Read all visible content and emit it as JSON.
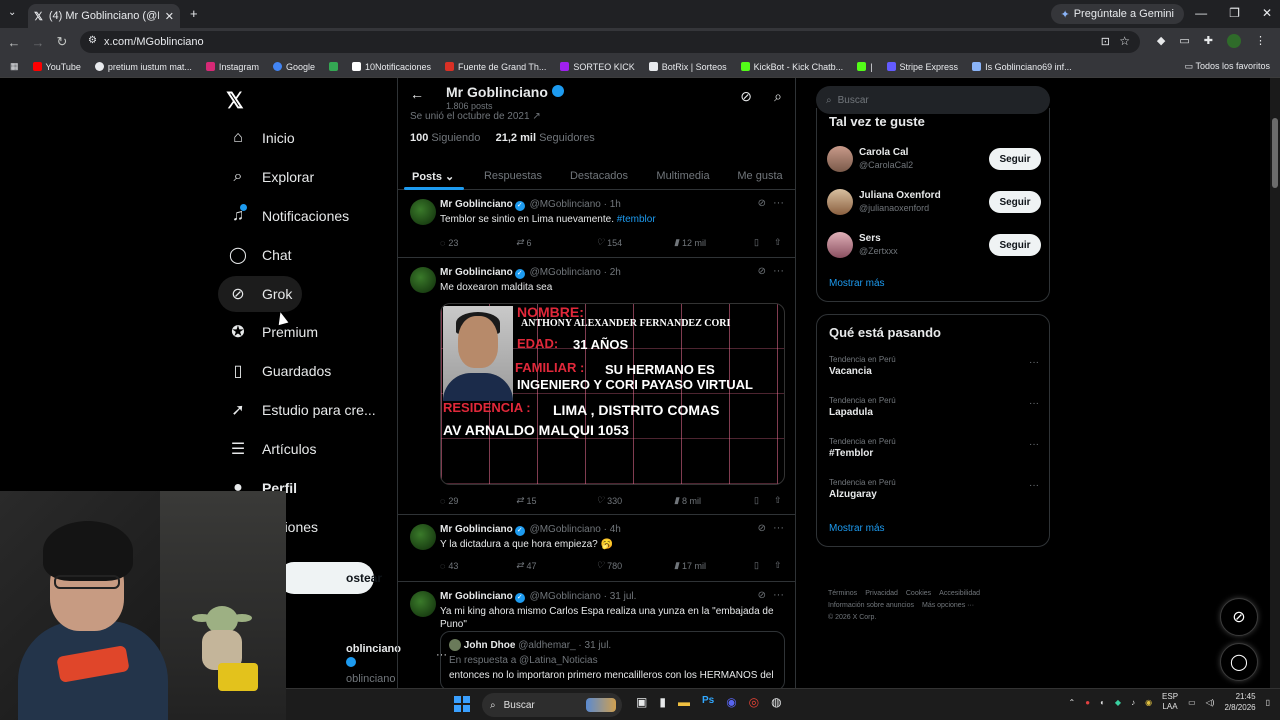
{
  "browser": {
    "tab_title": "(4) Mr Goblinciano (@MGoblin...",
    "gemini_label": "Pregúntale a Gemini",
    "url": "x.com/MGoblinciano",
    "bookmarks": [
      {
        "label": "YouTube",
        "color": "#ff0000"
      },
      {
        "label": "pretium iustum mat...",
        "color": "#e8eaed"
      },
      {
        "label": "Instagram",
        "color": "#d62976"
      },
      {
        "label": "Google",
        "color": "#4285f4"
      },
      {
        "label": "",
        "color": "#34a853"
      },
      {
        "label": "10Notificaciones",
        "color": "#ffffff"
      },
      {
        "label": "Fuente de Grand Th...",
        "color": "#d93025"
      },
      {
        "label": "SORTEO KICK",
        "color": "#a020f0"
      },
      {
        "label": "BotRix | Sorteos",
        "color": "#e8eaed"
      },
      {
        "label": "KickBot - Kick Chatb...",
        "color": "#53fc18"
      },
      {
        "label": "|",
        "color": "#53fc18"
      },
      {
        "label": "Stripe Express",
        "color": "#635bff"
      },
      {
        "label": "Is Goblinciano69 inf...",
        "color": "#8ab4f8"
      }
    ],
    "bookmarks_all": "Todos los favoritos"
  },
  "sidebar": {
    "logo": "𝕏",
    "items": [
      {
        "label": "Inicio",
        "icon": "home-icon",
        "glyph": "⌂"
      },
      {
        "label": "Explorar",
        "icon": "search-icon",
        "glyph": "⌕"
      },
      {
        "label": "Notificaciones",
        "icon": "bell-icon",
        "glyph": "🔔"
      },
      {
        "label": "Chat",
        "icon": "chat-icon",
        "glyph": "◯"
      },
      {
        "label": "Grok",
        "icon": "grok-icon",
        "glyph": "⊘"
      },
      {
        "label": "Premium",
        "icon": "premium-icon",
        "glyph": "✪"
      },
      {
        "label": "Guardados",
        "icon": "bookmark-icon",
        "glyph": "▯"
      },
      {
        "label": "Estudio para cre...",
        "icon": "rocket-icon",
        "glyph": "➚"
      },
      {
        "label": "Artículos",
        "icon": "article-icon",
        "glyph": "☰"
      },
      {
        "label": "Perfil",
        "icon": "person-icon",
        "glyph": "●"
      },
      {
        "label": "opciones",
        "icon": "more-options-icon",
        "glyph": "⋯"
      }
    ],
    "post_button": "ostear",
    "account_name": "oblinciano",
    "account_handle": "oblinciano"
  },
  "profile": {
    "name": "Mr Goblinciano",
    "posts_count": "1.806 posts",
    "joined": "Se unió el octubre de 2021 ↗",
    "following_count": "100",
    "following_label": "Siguiendo",
    "followers_count": "21,2 mil",
    "followers_label": "Seguidores",
    "tabs": [
      "Posts ⌄",
      "Respuestas",
      "Destacados",
      "Multimedia",
      "Me gusta"
    ]
  },
  "posts": [
    {
      "name": "Mr Goblinciano",
      "handle": "@MGoblinciano · 1h",
      "text": "Temblor se sintio en Lima nuevamente. ",
      "hashtag": "#temblor",
      "replies": "23",
      "reposts": "6",
      "likes": "154",
      "views": "12 mil"
    },
    {
      "name": "Mr Goblinciano",
      "handle": "@MGoblinciano · 2h",
      "text": "Me doxearon maldita sea",
      "replies": "29",
      "reposts": "15",
      "likes": "330",
      "views": "8 mil",
      "image_text": {
        "l1": "NOMBRE:",
        "l2": "ANTHONY ALEXANDER FERNANDEZ CORI",
        "l3": "EDAD:",
        "l3b": "31 AÑOS",
        "l4": "FAMILIAR :",
        "l4b": "SU HERMANO ES",
        "l5": "INGENIERO Y CORI PAYASO VIRTUAL",
        "l6": "RESIDENCIA :",
        "l6b": "LIMA , DISTRITO COMAS",
        "l7": "AV ARNALDO MALQUI 1053"
      }
    },
    {
      "name": "Mr Goblinciano",
      "handle": "@MGoblinciano · 4h",
      "text": "Y la dictadura a que hora empieza? 🥱",
      "replies": "43",
      "reposts": "47",
      "likes": "780",
      "views": "17 mil"
    },
    {
      "name": "Mr Goblinciano",
      "handle": "@MGoblinciano · 31 jul.",
      "text": "Ya mi king ahora mismo Carlos Espa realiza una yunza en la \"embajada de Puno\"",
      "quote": {
        "name": "John Dhoe",
        "handle": "@aldhemar_ · 31 jul.",
        "reply": "En respuesta a @Latina_Noticias",
        "body": "entonces no lo importaron primero mencalilleros con los HERMANOS del"
      }
    }
  ],
  "right": {
    "search_placeholder": "Buscar",
    "suggest_title": "Tal vez te guste",
    "suggestions": [
      {
        "name": "Carola Cal",
        "handle": "@CarolaCal2",
        "button": "Seguir"
      },
      {
        "name": "Juliana Oxenford",
        "handle": "@julianaoxenford",
        "button": "Seguir"
      },
      {
        "name": "Sers",
        "handle": "@Zertxxx",
        "button": "Seguir"
      }
    ],
    "show_more": "Mostrar más",
    "trends_title": "Qué está pasando",
    "trends": [
      {
        "context": "Tendencia en Perú",
        "name": "Vacancia"
      },
      {
        "context": "Tendencia en Perú",
        "name": "Lapadula"
      },
      {
        "context": "Tendencia en Perú",
        "name": "#Temblor"
      },
      {
        "context": "Tendencia en Perú",
        "name": "Alzugaray"
      }
    ],
    "trends_more": "Mostrar más",
    "footer_links": [
      "Términos",
      "Privacidad",
      "Cookies",
      "Accesibilidad",
      "Información sobre anuncios",
      "Más opciones ···",
      "© 2026 X Corp."
    ]
  },
  "taskbar": {
    "search": "Buscar",
    "lang1": "ESP",
    "lang2": "LAA",
    "time": "21:45",
    "date": "2/8/2026"
  }
}
